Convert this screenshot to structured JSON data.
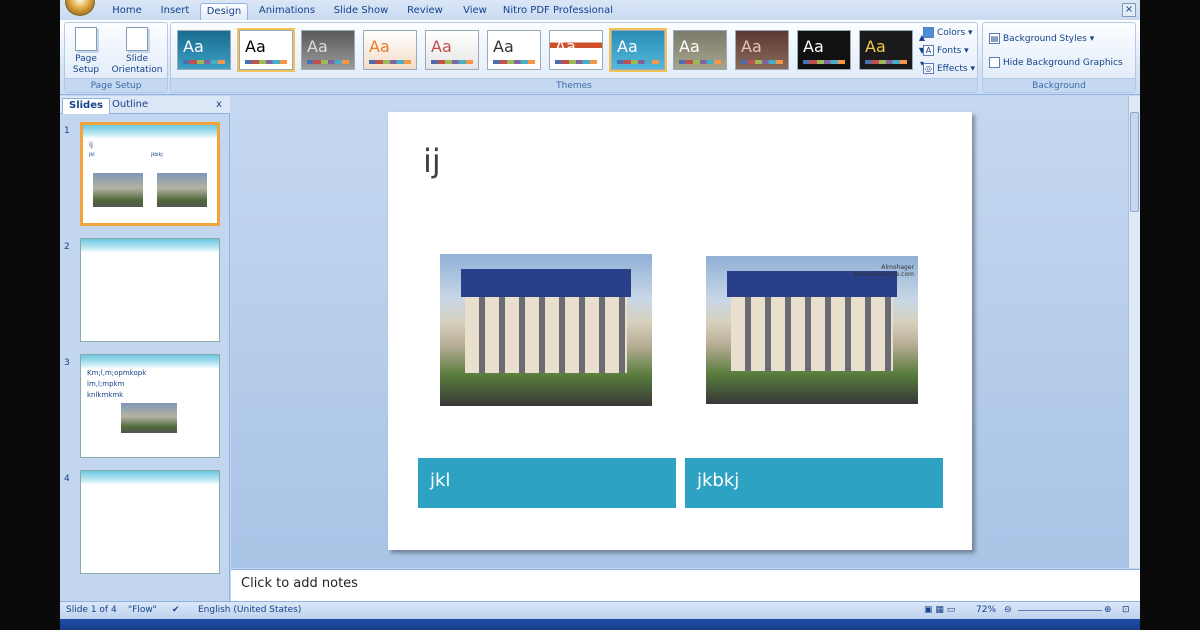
{
  "tabs": [
    "Home",
    "Insert",
    "Design",
    "Animations",
    "Slide Show",
    "Review",
    "View",
    "Nitro PDF Professional"
  ],
  "active_tab": "Design",
  "page_setup": {
    "page_setup_label": "Page Setup",
    "slide_orientation_label": "Slide Orientation",
    "group_label": "Page Setup"
  },
  "themes": {
    "group_label": "Themes",
    "sample": "Aa"
  },
  "theme_options": {
    "colors": "Colors",
    "fonts": "Fonts",
    "effects": "Effects"
  },
  "background": {
    "styles": "Background Styles",
    "hide": "Hide Background Graphics",
    "group_label": "Background"
  },
  "pane": {
    "slides_tab": "Slides",
    "outline_tab": "Outline",
    "close": "x"
  },
  "thumbs": [
    {
      "num": "1",
      "lines": [
        "ij",
        "jkl",
        "jkbkj"
      ]
    },
    {
      "num": "2",
      "lines": []
    },
    {
      "num": "3",
      "lines": [
        "Km;l,m;opmkopk",
        "lm,l;mpkm",
        "knlkmkmk"
      ]
    },
    {
      "num": "4",
      "lines": []
    }
  ],
  "slide": {
    "title": "ij",
    "picture_watermark": "Almohager\nwww.nileestate.com",
    "captions": [
      "jkl",
      "jkbkj"
    ]
  },
  "notes_placeholder": "Click to add notes",
  "status": {
    "slide_info": "Slide 1 of 4",
    "theme": "\"Flow\"",
    "language": "English (United States)",
    "zoom": "72%"
  },
  "colors": {
    "caption_bg": "#2ea2c3",
    "ribbon_text": "#15428b"
  }
}
